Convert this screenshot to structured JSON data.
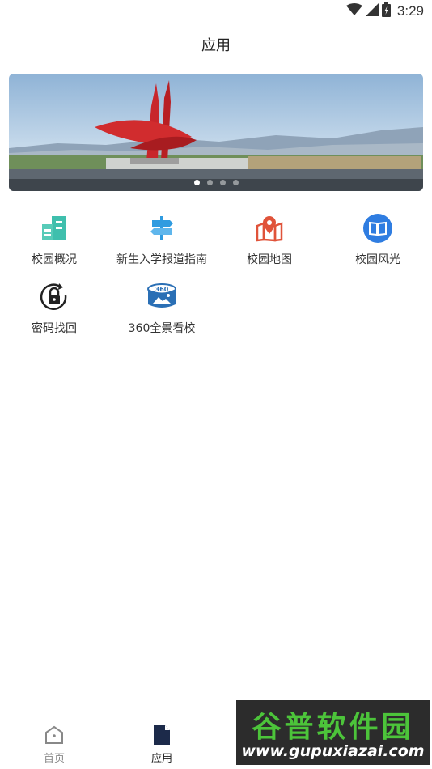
{
  "status_bar": {
    "time": "3:29"
  },
  "header": {
    "title": "应用"
  },
  "banner": {
    "slide_count": 4,
    "active_slide": 1
  },
  "apps": [
    {
      "label": "校园概况",
      "icon": "building-icon",
      "color": "#3fbfad"
    },
    {
      "label": "新生入学报道指南",
      "icon": "signpost-icon",
      "color": "#2f9be0"
    },
    {
      "label": "校园地图",
      "icon": "map-pin-icon",
      "color": "#e0533a"
    },
    {
      "label": "校园风光",
      "icon": "book-icon",
      "color": "#2f7de1"
    },
    {
      "label": "密码找回",
      "icon": "lock-reset-icon",
      "color": "#222222"
    },
    {
      "label": "360全景看校",
      "icon": "panorama-360-icon",
      "color": "#2a6fb5"
    }
  ],
  "bottom_nav": {
    "home_label": "首页",
    "apps_label": "应用"
  },
  "watermark": {
    "title": "谷普软件园",
    "url": "www.gupuxiazai.com"
  }
}
